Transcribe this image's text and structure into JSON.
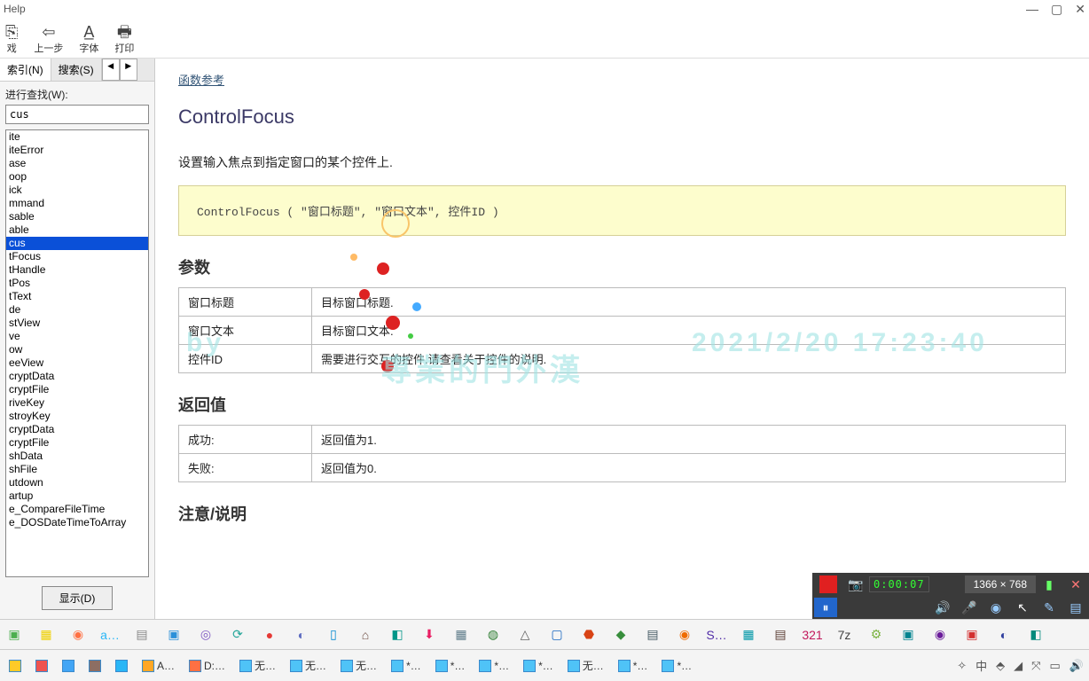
{
  "window": {
    "menu": "Help",
    "min": "—",
    "max": "▢",
    "close": "✕"
  },
  "toolbar": [
    {
      "icon": "⎘",
      "label": "戏"
    },
    {
      "icon": "⇦",
      "label": "上一步"
    },
    {
      "icon": "A̲",
      "label": "字体"
    },
    {
      "icon": "🖶",
      "label": "打印"
    }
  ],
  "sidebar": {
    "tabs": [
      "索引(N)",
      "搜索(S)"
    ],
    "nav": [
      "◀",
      "▶"
    ],
    "search_label": "进行查找(W):",
    "search_value": "cus",
    "items": [
      "ite",
      "iteError",
      "",
      "ase",
      "oop",
      "ick",
      "mmand",
      "sable",
      "able",
      "cus",
      "tFocus",
      "tHandle",
      "tPos",
      "tText",
      "de",
      "stView",
      "ve",
      "",
      "ow",
      "eeView",
      "",
      "cryptData",
      "cryptFile",
      "riveKey",
      "stroyKey",
      "cryptData",
      "cryptFile",
      "shData",
      "shFile",
      "utdown",
      "artup",
      "",
      "e_CompareFileTime",
      "e_DOSDateTimeToArray"
    ],
    "selected_index": 9,
    "show_button": "显示(D)"
  },
  "doc": {
    "breadcrumb": "函数参考",
    "title": "ControlFocus",
    "desc": "设置输入焦点到指定窗口的某个控件上.",
    "syntax": "ControlFocus ( \"窗口标题\", \"窗口文本\", 控件ID )",
    "sect_params": "参数",
    "params": [
      {
        "name": "窗口标题",
        "desc": "目标窗口标题."
      },
      {
        "name": "窗口文本",
        "desc": "目标窗口文本."
      },
      {
        "name": "控件ID",
        "desc": "需要进行交互的控件.请查看关于控件的说明."
      }
    ],
    "sect_return": "返回值",
    "returns": [
      {
        "name": "成功:",
        "desc": "返回值为1."
      },
      {
        "name": "失败:",
        "desc": "返回值为0."
      }
    ],
    "sect_notes": "注意/说明"
  },
  "recorder": {
    "time": "0:00:07",
    "resolution": "1366 × 768"
  },
  "task1": [
    {
      "c": "#4caf50",
      "t": ""
    },
    {
      "c": "#f0d000",
      "t": "▦"
    },
    {
      "c": "#ff7043",
      "t": "◉"
    },
    {
      "c": "#29b6f6",
      "t": "a…"
    },
    {
      "c": "#888",
      "t": "▤"
    },
    {
      "c": "#2b90d9",
      "t": "▣"
    },
    {
      "c": "#7e57c2",
      "t": "◎"
    },
    {
      "c": "#26a69a",
      "t": "⟳"
    },
    {
      "c": "#e53935",
      "t": "●"
    },
    {
      "c": "#5c6bc0",
      "t": "◐"
    },
    {
      "c": "#0288d1",
      "t": "▯"
    },
    {
      "c": "#6d4c41",
      "t": "⌂"
    },
    {
      "c": "#009688",
      "t": "◧"
    },
    {
      "c": "#e91e63",
      "t": "⬇"
    },
    {
      "c": "#607d8b",
      "t": "▦"
    },
    {
      "c": "#2e7d32",
      "t": "◍"
    },
    {
      "c": "#616161",
      "t": "△"
    },
    {
      "c": "#1565c0",
      "t": "▢"
    },
    {
      "c": "#d84315",
      "t": "⬣"
    },
    {
      "c": "#388e3c",
      "t": "◆"
    },
    {
      "c": "#455a64",
      "t": "▤"
    },
    {
      "c": "#ef6c00",
      "t": "◉"
    },
    {
      "c": "#512da8",
      "t": "S…"
    },
    {
      "c": "#0097a7",
      "t": "▦"
    },
    {
      "c": "#5d4037",
      "t": "▤"
    },
    {
      "c": "#c2185b",
      "t": "321"
    },
    {
      "c": "#424242",
      "t": "7z"
    },
    {
      "c": "#7cb342",
      "t": "⚙"
    },
    {
      "c": "#00838f",
      "t": "▣"
    },
    {
      "c": "#6a1b9a",
      "t": "◉"
    },
    {
      "c": "#d32f2f",
      "t": "▣"
    },
    {
      "c": "#303f9f",
      "t": "◐"
    },
    {
      "c": "#00897b",
      "t": "◧"
    }
  ],
  "task2": [
    {
      "c": "#ffca28",
      "t": ""
    },
    {
      "c": "#ef5350",
      "t": ""
    },
    {
      "c": "#42a5f5",
      "t": ""
    },
    {
      "c": "#8d6e63",
      "t": ""
    },
    {
      "c": "#29b6f6",
      "t": ""
    },
    {
      "c": "#ffa726",
      "t": "A…"
    },
    {
      "c": "#ff7043",
      "t": "D:…"
    },
    {
      "c": "#4fc3f7",
      "t": "无…"
    },
    {
      "c": "#4fc3f7",
      "t": "无…"
    },
    {
      "c": "#4fc3f7",
      "t": "无…"
    },
    {
      "c": "#4fc3f7",
      "t": "*…"
    },
    {
      "c": "#4fc3f7",
      "t": "*…"
    },
    {
      "c": "#4fc3f7",
      "t": "*…"
    },
    {
      "c": "#4fc3f7",
      "t": "*…"
    },
    {
      "c": "#4fc3f7",
      "t": "无…"
    },
    {
      "c": "#4fc3f7",
      "t": "*…"
    },
    {
      "c": "#4fc3f7",
      "t": "*…"
    }
  ],
  "tray": [
    "✧",
    "中",
    "⬘",
    "◢",
    "⤧",
    "▭",
    "🔊"
  ],
  "watermark": {
    "left": "by",
    "center": "專業的門外漢",
    "right": "2021/2/20 17:23:40"
  }
}
